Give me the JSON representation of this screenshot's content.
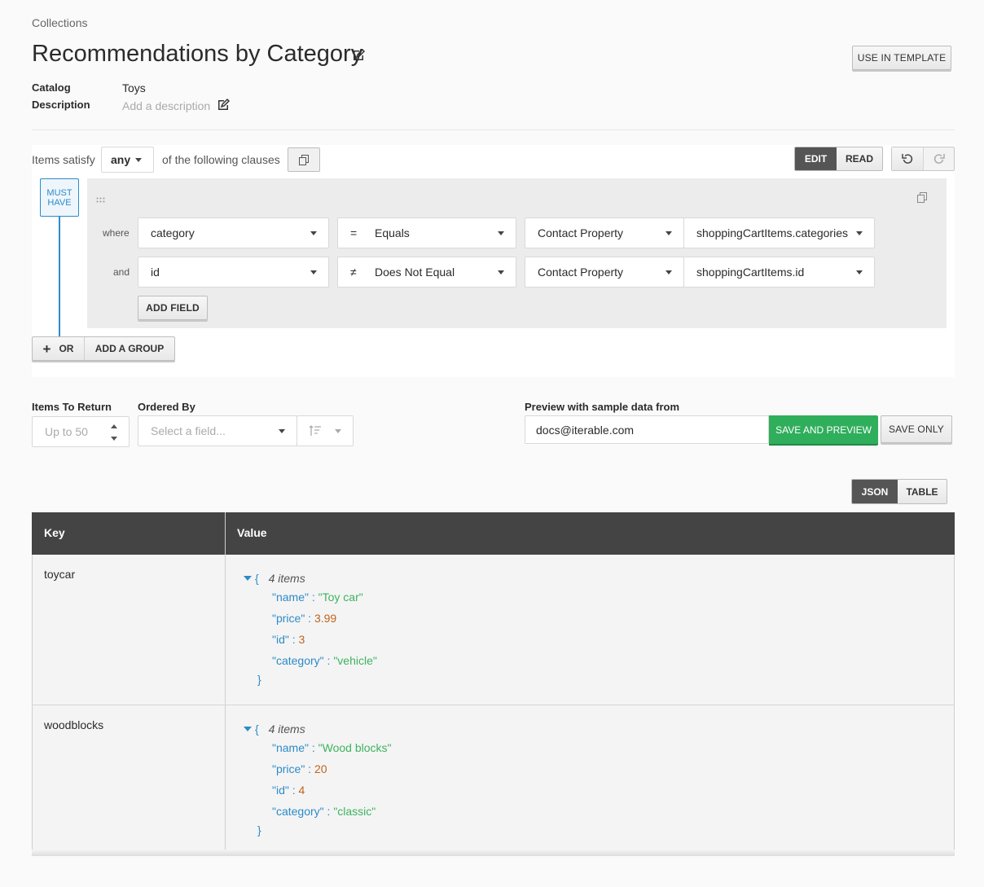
{
  "breadcrumb": "Collections",
  "page": {
    "title": "Recommendations by Category",
    "use_template_label": "USE IN TEMPLATE"
  },
  "meta": {
    "catalog_label": "Catalog",
    "catalog_value": "Toys",
    "description_label": "Description",
    "description_placeholder": "Add a description"
  },
  "clauses": {
    "prefix": "Items satisfy",
    "mode": "any",
    "suffix": "of the following clauses",
    "edit_label": "EDIT",
    "read_label": "READ",
    "must_have": [
      "MUST",
      "HAVE"
    ],
    "rows": [
      {
        "connector": "where",
        "field": "category",
        "op_symbol": "=",
        "op": "Equals",
        "source": "Contact Property",
        "value": "shoppingCartItems.categories"
      },
      {
        "connector": "and",
        "field": "id",
        "op_symbol": "≠",
        "op": "Does Not Equal",
        "source": "Contact Property",
        "value": "shoppingCartItems.id"
      }
    ],
    "add_field_label": "ADD FIELD",
    "or_label": "OR",
    "add_group_label": "ADD A GROUP"
  },
  "controls": {
    "items_to_return_label": "Items To Return",
    "items_to_return_placeholder": "Up to 50",
    "ordered_by_label": "Ordered By",
    "ordered_by_placeholder": "Select a field...",
    "preview_label": "Preview with sample data from",
    "preview_email": "docs@iterable.com",
    "save_preview_label": "SAVE AND PREVIEW",
    "save_only_label": "SAVE ONLY"
  },
  "view_toggle": {
    "json_label": "JSON",
    "table_label": "TABLE"
  },
  "table": {
    "key_header": "Key",
    "value_header": "Value",
    "rows": [
      {
        "key": "toycar",
        "open": "{",
        "count": "4 items",
        "close": "}",
        "fields": [
          {
            "k": "\"name\"",
            "v": "\"Toy car\"",
            "type": "str"
          },
          {
            "k": "\"price\"",
            "v": "3.99",
            "type": "num"
          },
          {
            "k": "\"id\"",
            "v": "3",
            "type": "num"
          },
          {
            "k": "\"category\"",
            "v": "\"vehicle\"",
            "type": "str"
          }
        ]
      },
      {
        "key": "woodblocks",
        "open": "{",
        "count": "4 items",
        "close": "}",
        "fields": [
          {
            "k": "\"name\"",
            "v": "\"Wood blocks\"",
            "type": "str"
          },
          {
            "k": "\"price\"",
            "v": "20",
            "type": "num"
          },
          {
            "k": "\"id\"",
            "v": "4",
            "type": "num"
          },
          {
            "k": "\"category\"",
            "v": "\"classic\"",
            "type": "str"
          }
        ]
      }
    ]
  },
  "colors": {
    "accent_blue": "#2d8bc8",
    "save_green": "#2fae5c",
    "header_dark": "#444444"
  }
}
